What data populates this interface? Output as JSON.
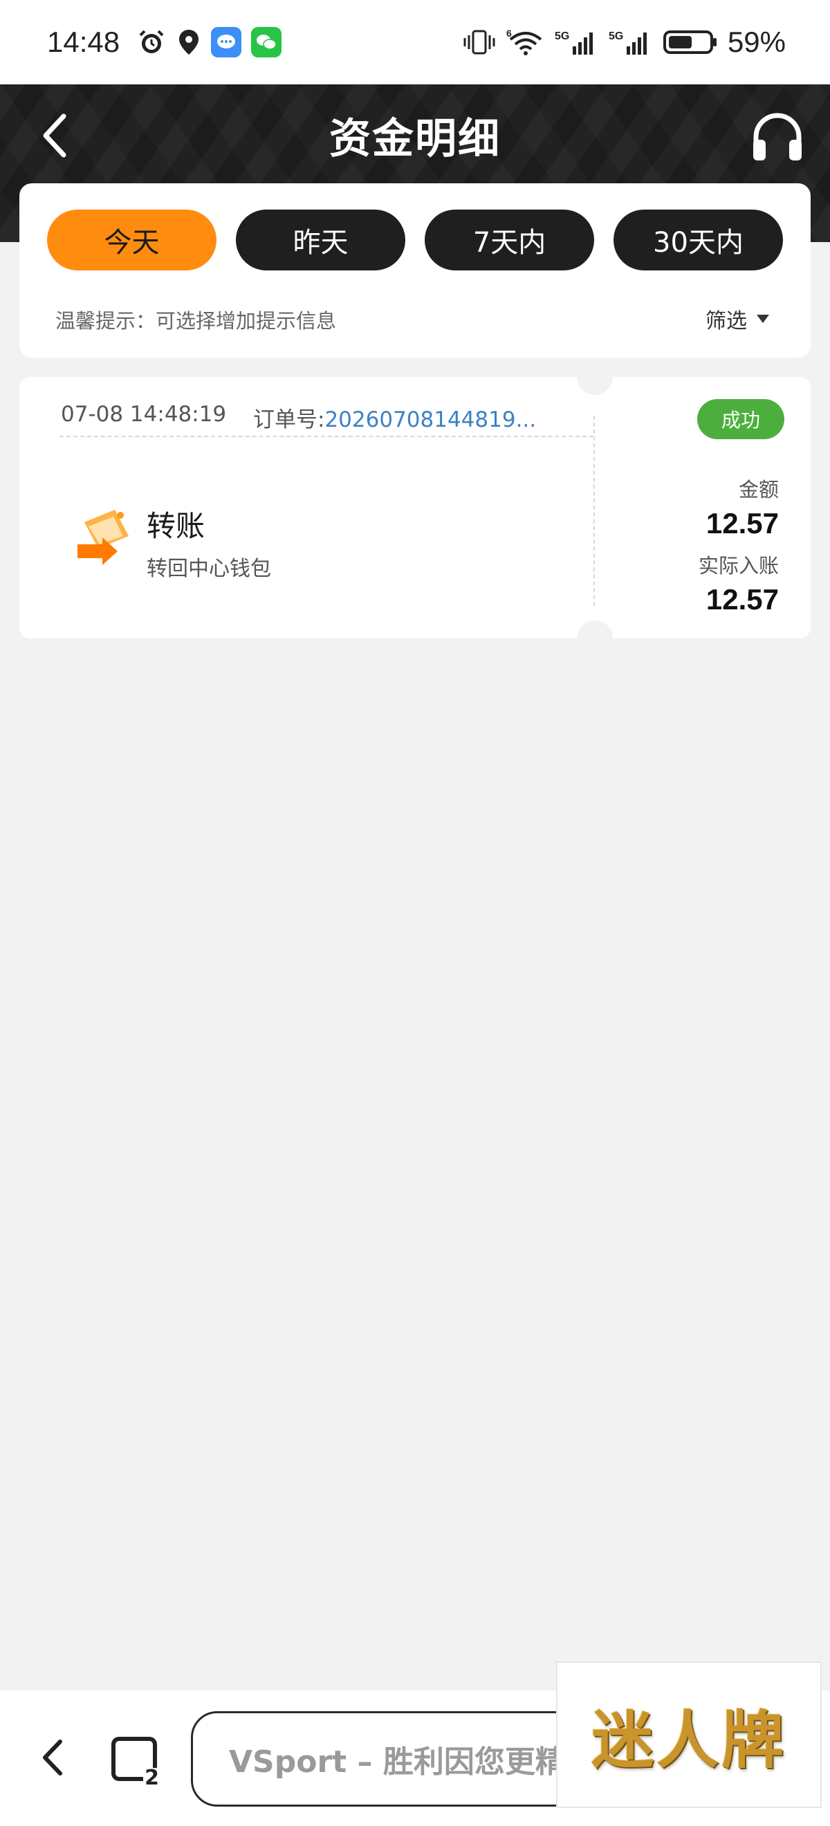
{
  "status_bar": {
    "time": "14:48",
    "battery_percent": "59%",
    "battery_level": 0.59,
    "left_icons": [
      "alarm-icon",
      "location-icon",
      "message-app-icon",
      "wechat-icon"
    ],
    "right_icons": [
      "vibrate-icon",
      "wifi-icon",
      "signal-5g-icon",
      "signal-5g-icon",
      "battery-icon"
    ],
    "network_label_1": "5G",
    "network_label_2": "5G",
    "wifi_label": "6"
  },
  "header": {
    "title": "资金明细",
    "back_icon": "chevron-left-icon",
    "support_icon": "headphones-icon"
  },
  "filters": {
    "tabs": [
      {
        "label": "今天",
        "active": true
      },
      {
        "label": "昨天",
        "active": false
      },
      {
        "label": "7天内",
        "active": false
      },
      {
        "label": "30天内",
        "active": false
      }
    ],
    "tip": "温馨提示：可选择增加提示信息",
    "filter_label": "筛选"
  },
  "records": [
    {
      "datetime": "07-08 14:48:19",
      "order_label": "订单号:",
      "order_no": "20260708144819...",
      "status": "成功",
      "type": "转账",
      "description": "转回中心钱包",
      "amount_label": "金额",
      "amount": "12.57",
      "actual_label": "实际入账",
      "actual_amount": "12.57"
    }
  ],
  "bottom_bar": {
    "url_text": "VSport – 胜利因您更精彩",
    "tabs_count": "2",
    "back_icon": "chevron-left-icon",
    "tabs_icon": "tabs-icon"
  },
  "logo": {
    "text": "迷人牌"
  },
  "colors": {
    "accent": "#ff8c0f",
    "success": "#4caf3d",
    "link": "#3b82c4",
    "header_bg": "#1c1c1c",
    "page_bg": "#f2f2f2"
  }
}
